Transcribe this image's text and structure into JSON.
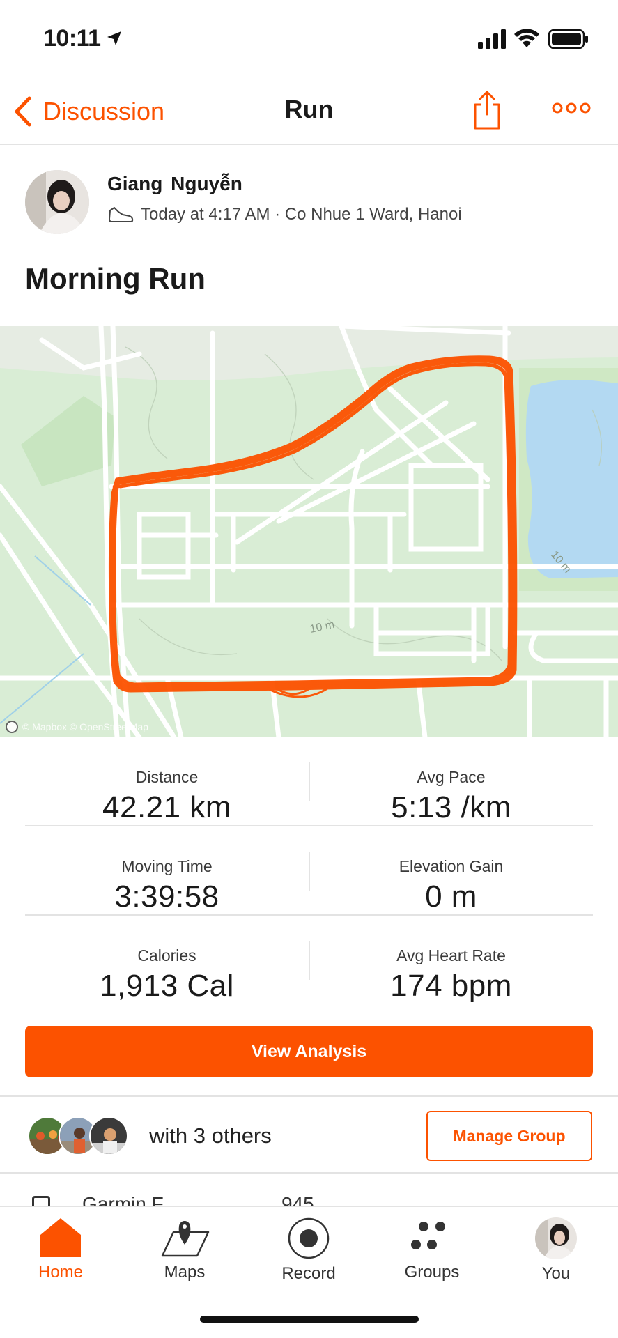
{
  "status_bar": {
    "time": "10:11"
  },
  "nav": {
    "back_label": "Discussion",
    "title": "Run"
  },
  "athlete": {
    "name": "Giang  Nguyễn",
    "meta": "Today at 4:17 AM · Co Nhue 1 Ward, Hanoi"
  },
  "activity": {
    "title": "Morning Run"
  },
  "map": {
    "attribution": "© Mapbox © OpenStreetMap",
    "contour_labels": [
      "10 m",
      "10 m"
    ]
  },
  "stats": [
    {
      "left": {
        "label": "Distance",
        "value": "42.21 km"
      },
      "right": {
        "label": "Avg Pace",
        "value": "5:13 /km"
      }
    },
    {
      "left": {
        "label": "Moving Time",
        "value": "3:39:58"
      },
      "right": {
        "label": "Elevation Gain",
        "value": "0 m"
      }
    },
    {
      "left": {
        "label": "Calories",
        "value": "1,913 Cal"
      },
      "right": {
        "label": "Avg Heart Rate",
        "value": "174 bpm"
      }
    }
  ],
  "analysis_button": "View Analysis",
  "group": {
    "text": "with 3 others",
    "manage_label": "Manage Group"
  },
  "peek": {
    "text": "Garmin F",
    "value": "945"
  },
  "tabs": [
    {
      "label": "Home",
      "icon": "home-icon",
      "active": true
    },
    {
      "label": "Maps",
      "icon": "maps-icon",
      "active": false
    },
    {
      "label": "Record",
      "icon": "record-icon",
      "active": false
    },
    {
      "label": "Groups",
      "icon": "groups-icon",
      "active": false
    },
    {
      "label": "You",
      "icon": "profile-avatar",
      "active": false
    }
  ],
  "colors": {
    "accent": "#fc5200",
    "map_bg": "#d9edd5",
    "water": "#b3d9f2",
    "route": "#fc5200"
  }
}
